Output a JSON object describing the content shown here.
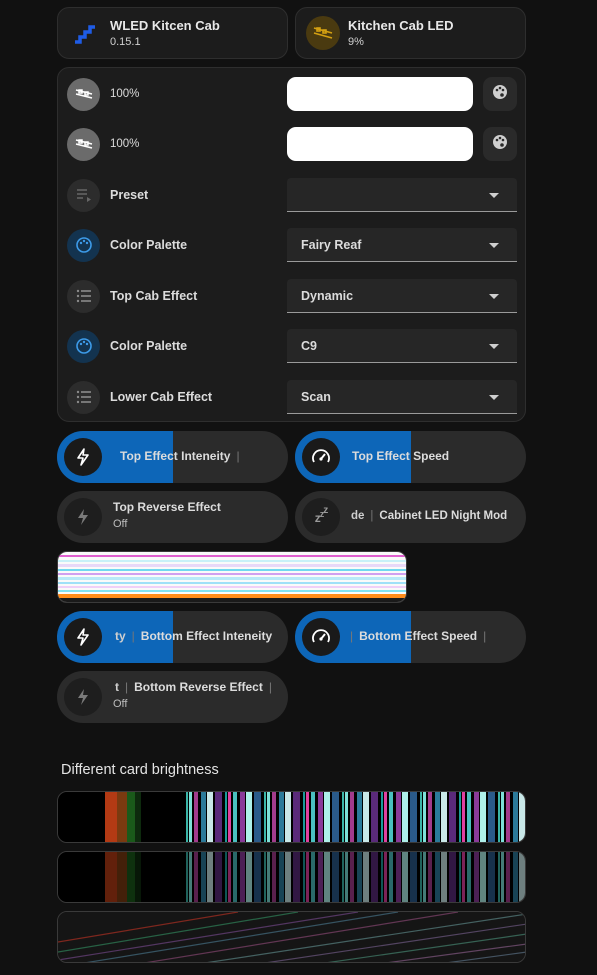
{
  "tiles": [
    {
      "name": "WLED Kitcen Cab",
      "sub": "0.15.1",
      "icon": "wled-logo-icon"
    },
    {
      "name": "Kitchen Cab LED",
      "sub": "9%",
      "icon": "led-strip-icon",
      "icon_color": "#d4a012"
    }
  ],
  "entities": {
    "rows": [
      {
        "label": "100%",
        "icon": "led-strip-icon"
      },
      {
        "label": "100%",
        "icon": "led-strip-icon"
      },
      {
        "label": "Preset",
        "icon": "playlist-play-icon",
        "value": ""
      },
      {
        "label": "Color Palette",
        "icon": "palette-icon",
        "value": "Fairy Reaf"
      },
      {
        "label": "Top Cab Effect",
        "icon": "list-icon",
        "value": "Dynamic"
      },
      {
        "label": "Color Palette",
        "icon": "palette-icon",
        "value": "C9"
      },
      {
        "label": "Lower Cab Effect",
        "icon": "list-icon",
        "value": "Scan"
      }
    ]
  },
  "pills": {
    "top_intensity": {
      "label": "Top Effect Inteneity",
      "sep": "|",
      "fill_percent": 50
    },
    "top_speed": {
      "label": "Top Effect Speed",
      "fill_percent": 50
    },
    "top_reverse": {
      "label": "Top Reverse Effect",
      "state": "Off"
    },
    "night_mode": {
      "prefix": "de",
      "sep": "|",
      "label": "Cabinet LED Night Mod"
    },
    "bottom_intensity": {
      "prefix": "ty",
      "sep": "|",
      "label": "Bottom Effect Inteneity",
      "fill_percent": 50
    },
    "bottom_speed": {
      "sep": "|",
      "label": "Bottom Effect Speed",
      "sep2": "|",
      "fill_percent": 50
    },
    "bottom_reverse": {
      "prefix": "t",
      "sep": "|",
      "label": "Bottom Reverse Effect",
      "sep2": "|",
      "state": "Off"
    }
  },
  "section_title": "Different card brightness",
  "colors": {
    "accent": "#0d66b8",
    "bg": "#111111",
    "card": "#1c1c1c"
  }
}
